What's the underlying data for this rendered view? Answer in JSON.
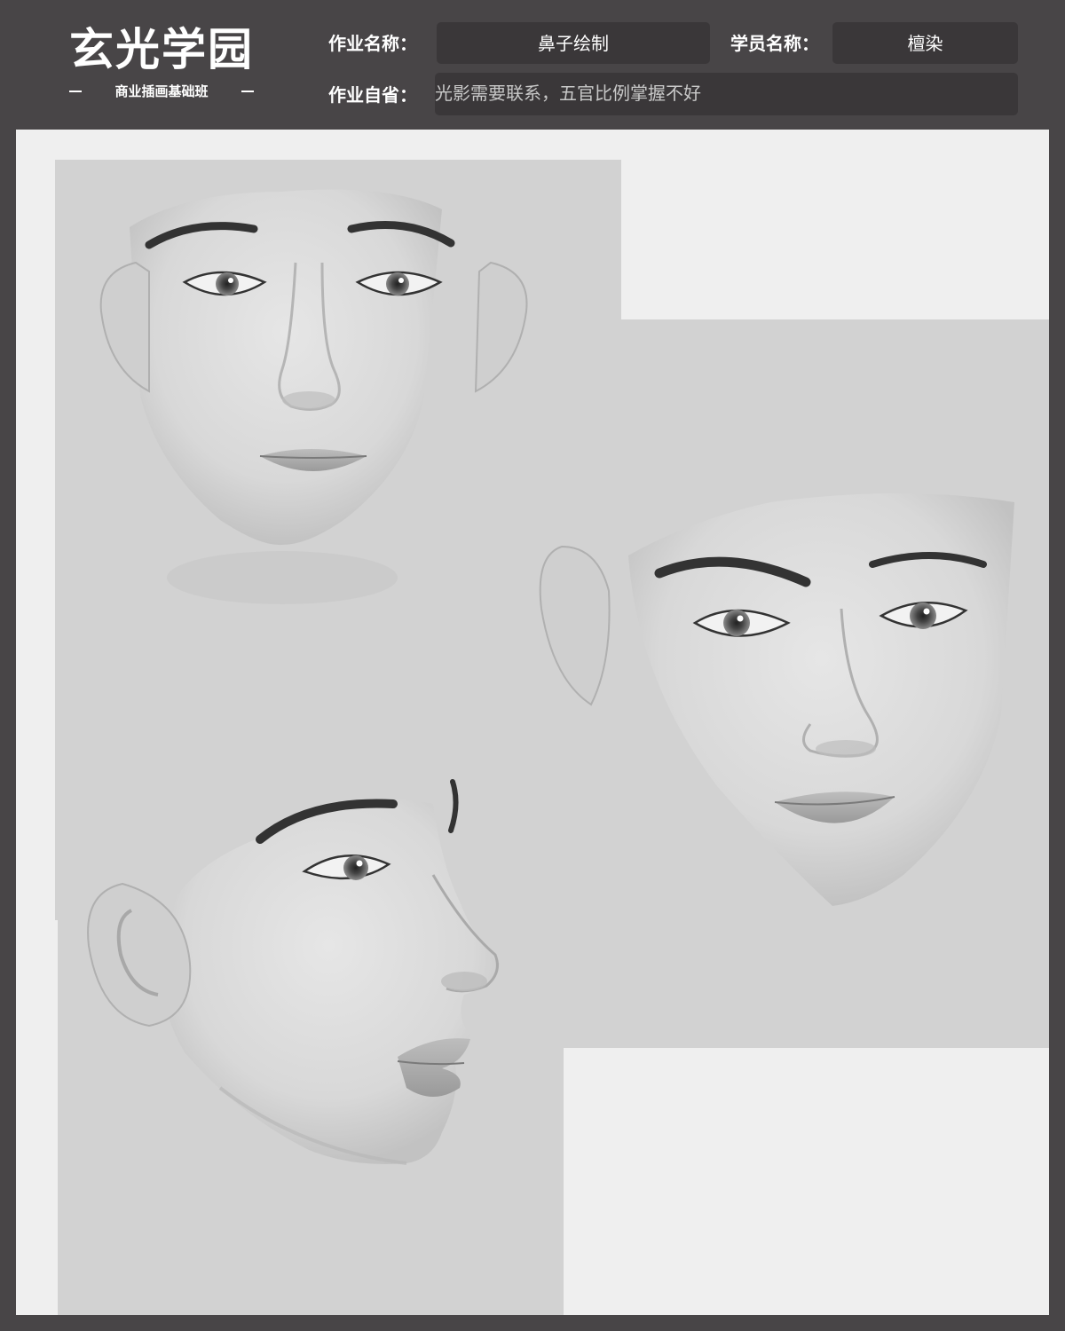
{
  "brand": {
    "title": "玄光学园",
    "subtitle": "商业插画基础班"
  },
  "form": {
    "homework_name_label": "作业名称：",
    "homework_name_value": "鼻子绘制",
    "student_name_label": "学员名称：",
    "student_name_value": "檀染",
    "reflection_label": "作业自省：",
    "reflection_value": "光影需要联系，五官比例掌握不好"
  },
  "colors": {
    "frame": "#484547",
    "field": "#3a3739",
    "canvas": "#efefef",
    "panel": "#d2d2d2"
  },
  "artwork": {
    "views": [
      "front-face",
      "three-quarter-face",
      "side-profile"
    ]
  }
}
